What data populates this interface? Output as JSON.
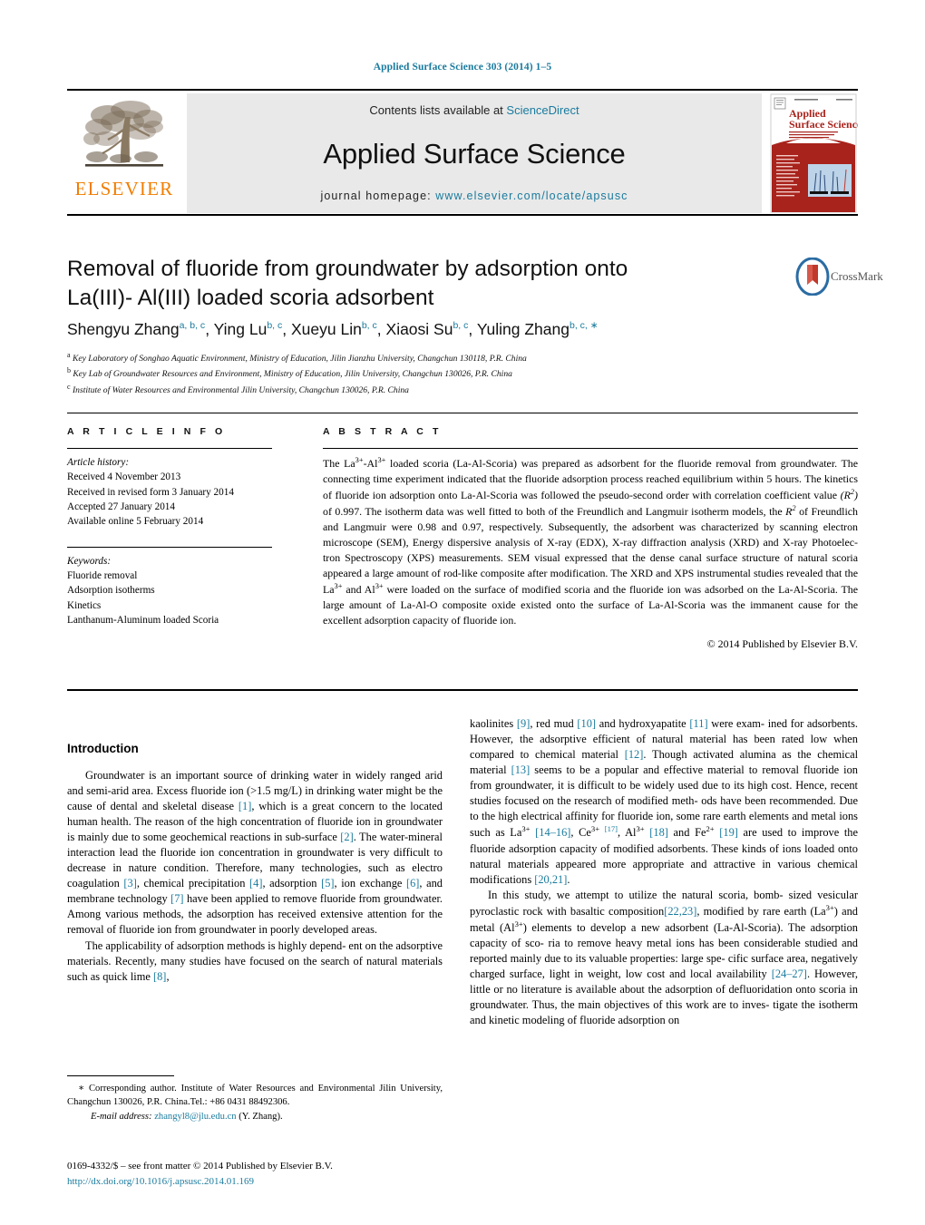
{
  "running_head": "Applied Surface Science 303 (2014) 1–5",
  "masthead": {
    "publisher_logo_text": "ELSEVIER",
    "contents_line_prefix": "Contents lists available at ",
    "contents_link": "ScienceDirect",
    "journal_name": "Applied Surface Science",
    "homepage_prefix": "journal homepage: ",
    "homepage_url": "www.elsevier.com/locate/apsusc",
    "cover_title_line1": "Applied",
    "cover_title_line2": "Surface Science"
  },
  "article": {
    "title_line1": "Removal of fluoride from groundwater by adsorption onto",
    "title_line2": "La(III)- Al(III) loaded scoria adsorbent",
    "crossmark_label": "CrossMark",
    "authors": [
      {
        "name": "Shengyu Zhang",
        "sup": "a, b, c"
      },
      {
        "name": "Ying Lu",
        "sup": "b, c"
      },
      {
        "name": "Xueyu Lin",
        "sup": "b, c"
      },
      {
        "name": "Xiaosi Su",
        "sup": "b, c"
      },
      {
        "name": "Yuling Zhang",
        "sup": "b, c, ∗"
      }
    ],
    "affiliations": [
      {
        "mark": "a",
        "text": "Key Laboratory of Songhao Aquatic Environment, Ministry of Education, Jilin Jianzhu University, Changchun 130118, P.R. China"
      },
      {
        "mark": "b",
        "text": "Key Lab of Groundwater Resources and Environment, Ministry of Education, Jilin University, Changchun 130026, P.R. China"
      },
      {
        "mark": "c",
        "text": "Institute of Water Resources and Environmental Jilin University, Changchun 130026, P.R. China"
      }
    ]
  },
  "article_info": {
    "heading": "A R T I C L E    I N F O",
    "history_title": "Article history:",
    "history": [
      "Received 4 November 2013",
      "Received in revised form 3 January 2014",
      "Accepted 27 January 2014",
      "Available online 5 February 2014"
    ],
    "keywords_title": "Keywords:",
    "keywords": [
      "Fluoride removal",
      "Adsorption isotherms",
      "Kinetics",
      "Lanthanum-Aluminum loaded Scoria"
    ]
  },
  "abstract": {
    "heading": "A B S T R A C T",
    "copyright": "© 2014 Published by Elsevier B.V."
  },
  "body": {
    "intro_heading": "Introduction",
    "footnote_marker": "∗",
    "footnote_text": "Corresponding author. Institute of Water Resources and Environmental Jilin University, Changchun 130026, P.R. China.Tel.: +86 0431 88492306.",
    "email_label": "E-mail address:",
    "email": "zhangyl8@jlu.edu.cn",
    "email_suffix": "(Y. Zhang).",
    "imprint": "0169-4332/$ – see front matter © 2014 Published by Elsevier B.V.",
    "doi": "http://dx.doi.org/10.1016/j.apsusc.2014.01.169"
  },
  "colors": {
    "link": "#1a7b9e",
    "elsevier_orange": "#f07d00",
    "cover_red": "#b02a20",
    "crossmark_blue": "#2b6ca3",
    "crossmark_red": "#c0392b"
  }
}
